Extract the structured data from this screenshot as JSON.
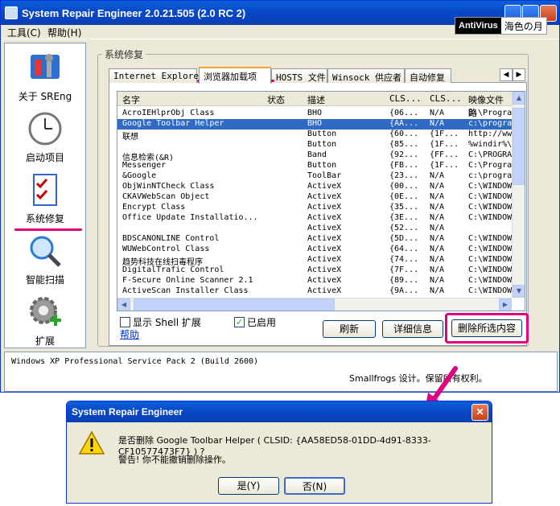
{
  "window": {
    "title": "System Repair Engineer 2.0.21.505 (2.0 RC 2)"
  },
  "badge": {
    "av": "AntiVirus",
    "name": "海色の月"
  },
  "menu": [
    "工具(C)",
    "帮助(H)"
  ],
  "sidebar": [
    {
      "label": "关于 SREng",
      "icon": "tools-icon"
    },
    {
      "label": "启动项目",
      "icon": "clock-icon"
    },
    {
      "label": "系统修复",
      "icon": "checklist-icon"
    },
    {
      "label": "智能扫描",
      "icon": "magnifier-icon"
    },
    {
      "label": "扩展",
      "icon": "gear-plus-icon"
    }
  ],
  "group_label": "系统修复",
  "tabs": [
    "Internet Explorer",
    "浏览器加载项",
    "HOSTS 文件",
    "Winsock 供应者",
    "自动修复"
  ],
  "columns": [
    "名字",
    "状态",
    "描述",
    "CLS...",
    "CLS...",
    "映像文件路"
  ],
  "rows": [
    [
      "AcroIEHlprObj Class",
      "",
      "BHO",
      "{06...",
      "N/A",
      "D:\\Progra"
    ],
    [
      "Google Toolbar Helper",
      "",
      "BHO",
      "{AA...",
      "N/A",
      "c:\\progra"
    ],
    [
      "联想",
      "",
      "Button",
      "{60...",
      "{1F...",
      "http://ww"
    ],
    [
      "",
      "",
      "Button",
      "{85...",
      "{1F...",
      "%windir%\\"
    ],
    [
      "信息检索(&R)",
      "",
      "Band",
      "{92...",
      "{FF...",
      "C:\\PROGRA"
    ],
    [
      "Messenger",
      "",
      "Button",
      "{FB...",
      "{1F...",
      "C:\\Progra"
    ],
    [
      "&Google",
      "",
      "ToolBar",
      "{23...",
      "N/A",
      "c:\\progra"
    ],
    [
      "ObjWinNTCheck Class",
      "",
      "ActiveX",
      "{00...",
      "N/A",
      "C:\\WINDOW"
    ],
    [
      "CKAVWebScan Object",
      "",
      "ActiveX",
      "{0E...",
      "N/A",
      "C:\\WINDOW"
    ],
    [
      "Encrypt Class",
      "",
      "ActiveX",
      "{35...",
      "N/A",
      "C:\\WINDOW"
    ],
    [
      "Office Update Installatio...",
      "",
      "ActiveX",
      "{3E...",
      "N/A",
      "C:\\WINDOW"
    ],
    [
      "",
      "",
      "ActiveX",
      "{52...",
      "N/A",
      ""
    ],
    [
      "BDSCANONLINE Control",
      "",
      "ActiveX",
      "{5D...",
      "N/A",
      "C:\\WINDOW"
    ],
    [
      "WUWebControl Class",
      "",
      "ActiveX",
      "{64...",
      "N/A",
      "C:\\WINDOW"
    ],
    [
      "趋势科技在线扫毒程序",
      "",
      "ActiveX",
      "{74...",
      "N/A",
      "C:\\WINDOW"
    ],
    [
      "DigitalTrafic Control",
      "",
      "ActiveX",
      "{7F...",
      "N/A",
      "C:\\WINDOW"
    ],
    [
      "F-Secure Online Scanner 2.1",
      "",
      "ActiveX",
      "{89...",
      "N/A",
      "C:\\WINDOW"
    ],
    [
      "ActiveScan Installer Class",
      "",
      "ActiveX",
      "{9A...",
      "N/A",
      "C:\\WINDOW"
    ]
  ],
  "checks": {
    "shell": "显示 Shell 扩展",
    "enabled": "已启用"
  },
  "help": "帮助",
  "buttons": {
    "refresh": "刷新",
    "details": "详细信息",
    "delete": "删除所选内容"
  },
  "status": {
    "os": "Windows XP Professional Service Pack 2 (Build 2600)",
    "credit": "Smallfrogs 设计。保留所有权利。"
  },
  "dialog": {
    "title": "System Repair Engineer",
    "msg": "是否删除 Google Toolbar Helper ( CLSID: {AA58ED58-01DD-4d91-8333-CF10577473F7} ) ?",
    "warn": "警告! 你不能撤销删除操作。",
    "yes": "是(Y)",
    "no": "否(N)"
  },
  "colors": {
    "accent": "#e0007e",
    "selection": "#316ac5"
  }
}
